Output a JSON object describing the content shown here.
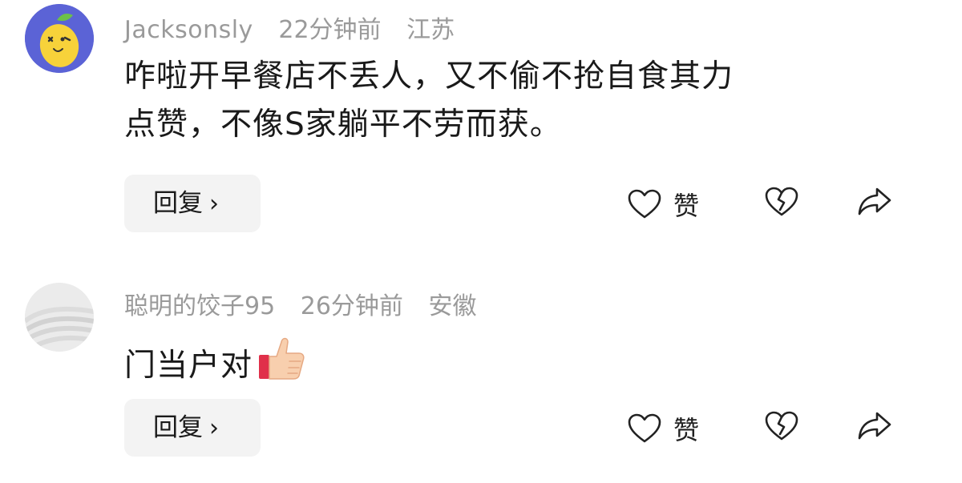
{
  "comments": [
    {
      "username": "Jacksonsly",
      "time": "22分钟前",
      "location": "江苏",
      "text_line1": "咋啦开早餐店不丢人，又不偷不抢自食其力",
      "text_line2": "点赞，不像S家躺平不劳而获。",
      "reply_label": "回复",
      "like_label": "赞"
    },
    {
      "username": "聪明的饺子95",
      "time": "26分钟前",
      "location": "安徽",
      "text_line1": "门当户对",
      "reply_label": "回复",
      "like_label": "赞"
    }
  ],
  "icons": {
    "reply_chevron": "›",
    "heart": "heart-icon",
    "broken_heart": "broken-heart-icon",
    "share": "share-arrow-icon",
    "thumbs_up": "thumbs-up-emoji"
  },
  "colors": {
    "avatar1_bg": "#5b63d6",
    "avatar2_bg": "#e6e6e6",
    "meta_text": "#9a9a9a",
    "reply_bg": "#f3f3f3"
  }
}
